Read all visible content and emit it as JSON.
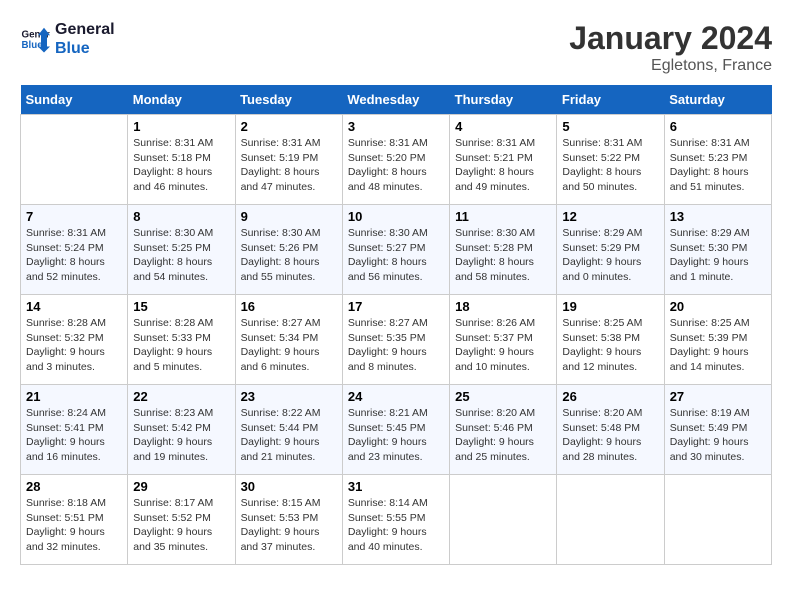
{
  "header": {
    "logo_line1": "General",
    "logo_line2": "Blue",
    "month": "January 2024",
    "location": "Egletons, France"
  },
  "days_of_week": [
    "Sunday",
    "Monday",
    "Tuesday",
    "Wednesday",
    "Thursday",
    "Friday",
    "Saturday"
  ],
  "weeks": [
    [
      {
        "num": "",
        "info": ""
      },
      {
        "num": "1",
        "info": "Sunrise: 8:31 AM\nSunset: 5:18 PM\nDaylight: 8 hours\nand 46 minutes."
      },
      {
        "num": "2",
        "info": "Sunrise: 8:31 AM\nSunset: 5:19 PM\nDaylight: 8 hours\nand 47 minutes."
      },
      {
        "num": "3",
        "info": "Sunrise: 8:31 AM\nSunset: 5:20 PM\nDaylight: 8 hours\nand 48 minutes."
      },
      {
        "num": "4",
        "info": "Sunrise: 8:31 AM\nSunset: 5:21 PM\nDaylight: 8 hours\nand 49 minutes."
      },
      {
        "num": "5",
        "info": "Sunrise: 8:31 AM\nSunset: 5:22 PM\nDaylight: 8 hours\nand 50 minutes."
      },
      {
        "num": "6",
        "info": "Sunrise: 8:31 AM\nSunset: 5:23 PM\nDaylight: 8 hours\nand 51 minutes."
      }
    ],
    [
      {
        "num": "7",
        "info": "Sunrise: 8:31 AM\nSunset: 5:24 PM\nDaylight: 8 hours\nand 52 minutes."
      },
      {
        "num": "8",
        "info": "Sunrise: 8:30 AM\nSunset: 5:25 PM\nDaylight: 8 hours\nand 54 minutes."
      },
      {
        "num": "9",
        "info": "Sunrise: 8:30 AM\nSunset: 5:26 PM\nDaylight: 8 hours\nand 55 minutes."
      },
      {
        "num": "10",
        "info": "Sunrise: 8:30 AM\nSunset: 5:27 PM\nDaylight: 8 hours\nand 56 minutes."
      },
      {
        "num": "11",
        "info": "Sunrise: 8:30 AM\nSunset: 5:28 PM\nDaylight: 8 hours\nand 58 minutes."
      },
      {
        "num": "12",
        "info": "Sunrise: 8:29 AM\nSunset: 5:29 PM\nDaylight: 9 hours\nand 0 minutes."
      },
      {
        "num": "13",
        "info": "Sunrise: 8:29 AM\nSunset: 5:30 PM\nDaylight: 9 hours\nand 1 minute."
      }
    ],
    [
      {
        "num": "14",
        "info": "Sunrise: 8:28 AM\nSunset: 5:32 PM\nDaylight: 9 hours\nand 3 minutes."
      },
      {
        "num": "15",
        "info": "Sunrise: 8:28 AM\nSunset: 5:33 PM\nDaylight: 9 hours\nand 5 minutes."
      },
      {
        "num": "16",
        "info": "Sunrise: 8:27 AM\nSunset: 5:34 PM\nDaylight: 9 hours\nand 6 minutes."
      },
      {
        "num": "17",
        "info": "Sunrise: 8:27 AM\nSunset: 5:35 PM\nDaylight: 9 hours\nand 8 minutes."
      },
      {
        "num": "18",
        "info": "Sunrise: 8:26 AM\nSunset: 5:37 PM\nDaylight: 9 hours\nand 10 minutes."
      },
      {
        "num": "19",
        "info": "Sunrise: 8:25 AM\nSunset: 5:38 PM\nDaylight: 9 hours\nand 12 minutes."
      },
      {
        "num": "20",
        "info": "Sunrise: 8:25 AM\nSunset: 5:39 PM\nDaylight: 9 hours\nand 14 minutes."
      }
    ],
    [
      {
        "num": "21",
        "info": "Sunrise: 8:24 AM\nSunset: 5:41 PM\nDaylight: 9 hours\nand 16 minutes."
      },
      {
        "num": "22",
        "info": "Sunrise: 8:23 AM\nSunset: 5:42 PM\nDaylight: 9 hours\nand 19 minutes."
      },
      {
        "num": "23",
        "info": "Sunrise: 8:22 AM\nSunset: 5:44 PM\nDaylight: 9 hours\nand 21 minutes."
      },
      {
        "num": "24",
        "info": "Sunrise: 8:21 AM\nSunset: 5:45 PM\nDaylight: 9 hours\nand 23 minutes."
      },
      {
        "num": "25",
        "info": "Sunrise: 8:20 AM\nSunset: 5:46 PM\nDaylight: 9 hours\nand 25 minutes."
      },
      {
        "num": "26",
        "info": "Sunrise: 8:20 AM\nSunset: 5:48 PM\nDaylight: 9 hours\nand 28 minutes."
      },
      {
        "num": "27",
        "info": "Sunrise: 8:19 AM\nSunset: 5:49 PM\nDaylight: 9 hours\nand 30 minutes."
      }
    ],
    [
      {
        "num": "28",
        "info": "Sunrise: 8:18 AM\nSunset: 5:51 PM\nDaylight: 9 hours\nand 32 minutes."
      },
      {
        "num": "29",
        "info": "Sunrise: 8:17 AM\nSunset: 5:52 PM\nDaylight: 9 hours\nand 35 minutes."
      },
      {
        "num": "30",
        "info": "Sunrise: 8:15 AM\nSunset: 5:53 PM\nDaylight: 9 hours\nand 37 minutes."
      },
      {
        "num": "31",
        "info": "Sunrise: 8:14 AM\nSunset: 5:55 PM\nDaylight: 9 hours\nand 40 minutes."
      },
      {
        "num": "",
        "info": ""
      },
      {
        "num": "",
        "info": ""
      },
      {
        "num": "",
        "info": ""
      }
    ]
  ]
}
